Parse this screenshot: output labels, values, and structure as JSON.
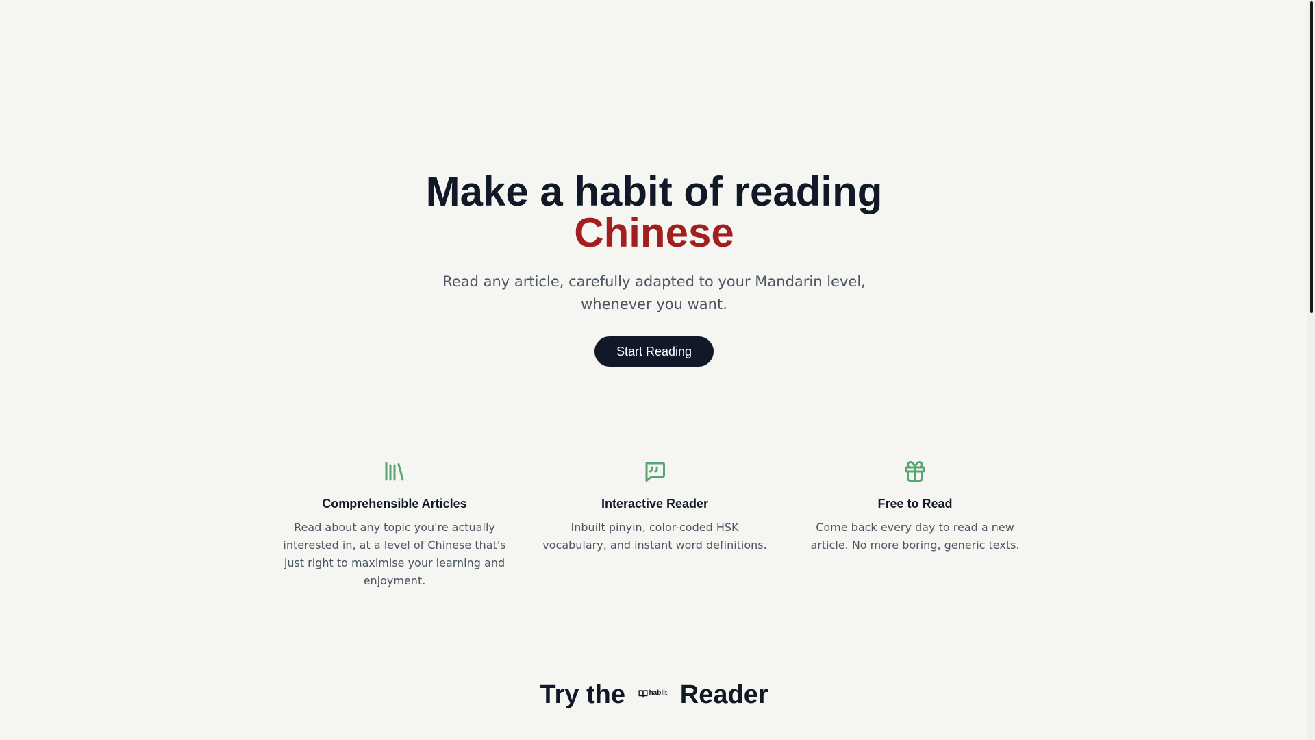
{
  "hero": {
    "title_line1": "Make a habit of reading",
    "title_line2": "Chinese",
    "subtitle": "Read any article, carefully adapted to your Mandarin level, whenever you want.",
    "cta_label": "Start Reading"
  },
  "features": [
    {
      "icon": "library-icon",
      "title": "Comprehensible Articles",
      "text": "Read about any topic you're actually interested in, at a level of Chinese that's just right to maximise your learning and enjoyment."
    },
    {
      "icon": "quote-message-icon",
      "title": "Interactive Reader",
      "text": "Inbuilt pinyin, color-coded HSK vocabulary, and instant word definitions."
    },
    {
      "icon": "gift-icon",
      "title": "Free to Read",
      "text": "Come back every day to read a new article. No more boring, generic texts."
    }
  ],
  "try_section": {
    "prefix": "Try the",
    "logo_text": "hablit",
    "suffix": "Reader"
  },
  "colors": {
    "background": "#f5f5f2",
    "text_dark": "#111827",
    "accent_red": "#a31f1f",
    "icon_green": "#5aa372",
    "body_gray": "#4b5563"
  }
}
